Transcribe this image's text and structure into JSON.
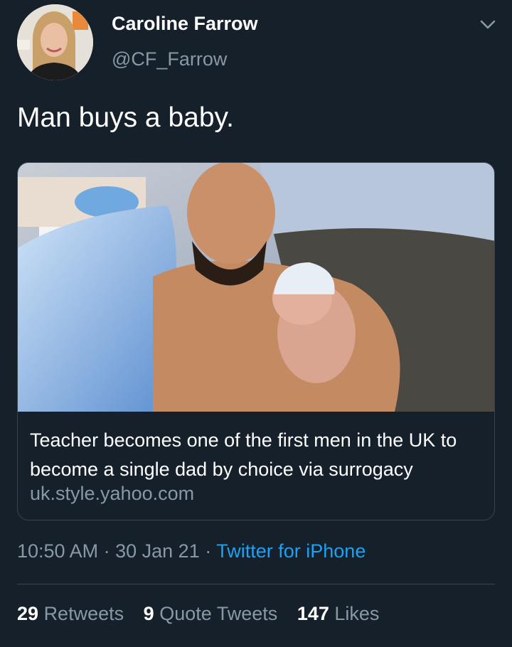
{
  "author": {
    "name": "Caroline Farrow",
    "handle": "@CF_Farrow"
  },
  "tweet": {
    "text": "Man buys a baby."
  },
  "card": {
    "title": "Teacher becomes one of the first men in the UK to become a single dad by choice via surrogacy",
    "domain": "uk.style.yahoo.com"
  },
  "meta": {
    "time": "10:50 AM",
    "separator": "·",
    "date": "30 Jan 21",
    "source": "Twitter for iPhone"
  },
  "stats": {
    "retweets_count": "29",
    "retweets_label": "Retweets",
    "quotes_count": "9",
    "quotes_label": "Quote Tweets",
    "likes_count": "147",
    "likes_label": "Likes"
  },
  "icons": {
    "menu": "chevron-down-icon"
  },
  "colors": {
    "background": "#15202b",
    "secondary_text": "#8899a6",
    "link": "#1da1f2",
    "border": "#38444d"
  }
}
